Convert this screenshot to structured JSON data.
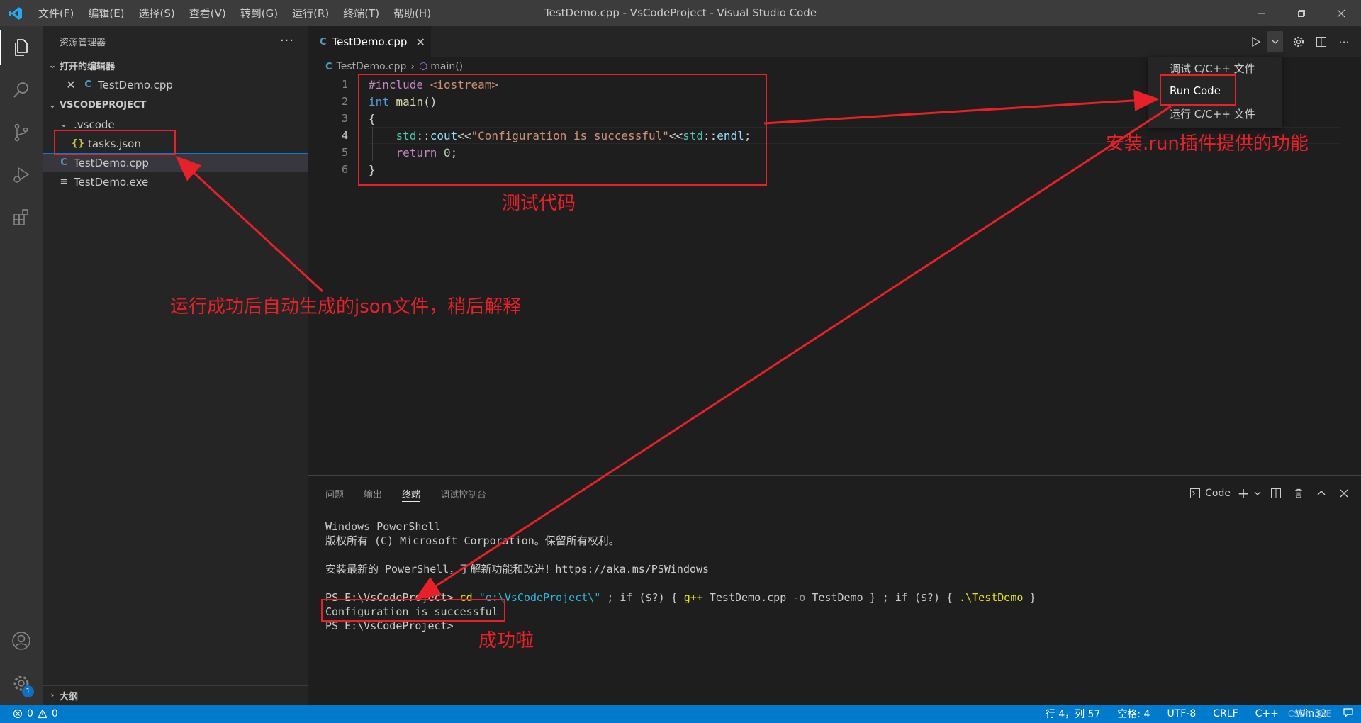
{
  "titlebar": {
    "menu": [
      "文件(F)",
      "编辑(E)",
      "选择(S)",
      "查看(V)",
      "转到(G)",
      "运行(R)",
      "终端(T)",
      "帮助(H)"
    ],
    "window_title": "TestDemo.cpp - VsCodeProject - Visual Studio Code"
  },
  "sidebar": {
    "header": "资源管理器",
    "more": "···",
    "open_editors": {
      "label": "打开的编辑器",
      "files": [
        {
          "name": "TestDemo.cpp"
        }
      ]
    },
    "project": {
      "label": "VSCODEPROJECT",
      "folder": ".vscode",
      "folder_files": [
        {
          "name": "tasks.json"
        }
      ],
      "files": [
        {
          "name": "TestDemo.cpp"
        },
        {
          "name": "TestDemo.exe"
        }
      ]
    },
    "outline": "大纲"
  },
  "activity_badge": "1",
  "tab": {
    "name": "TestDemo.cpp",
    "close": "✕"
  },
  "breadcrumb": {
    "file": "TestDemo.cpp",
    "symbol": "main()"
  },
  "editor": {
    "line_numbers": [
      "1",
      "2",
      "3",
      "4",
      "5",
      "6"
    ]
  },
  "run_menu": {
    "items": [
      "调试 C/C++ 文件",
      "Run Code",
      "运行 C/C++ 文件"
    ]
  },
  "panel": {
    "tabs": [
      "问题",
      "输出",
      "终端",
      "调试控制台"
    ],
    "active_tab": "终端",
    "terminal_name": "Code",
    "terminal": {
      "line1": "Windows PowerShell",
      "line2": "版权所有 (C) Microsoft Corporation。保留所有权利。",
      "line3": "安装最新的 PowerShell，了解新功能和改进！https://aka.ms/PSWindows",
      "prompt": "PS E:\\VsCodeProject> ",
      "cmd_cd": "cd",
      "cmd_path": "\"e:\\VsCodeProject\\\"",
      "cmd_rest1": " ; if ($?) { ",
      "cmd_gpp": "g++",
      "cmd_rest2": " TestDemo.cpp ",
      "cmd_o": "-o",
      "cmd_rest3": " TestDemo } ; if ($?) { ",
      "cmd_exe": ".\\TestDemo",
      "cmd_rest4": " }",
      "output": "Configuration is successful",
      "prompt2": "PS E:\\VsCodeProject> "
    }
  },
  "statusbar": {
    "errors": "0",
    "warnings": "0",
    "position": "行 4，列 57",
    "spaces": "空格: 4",
    "encoding": "UTF-8",
    "eol": "CRLF",
    "language": "C++",
    "platform": "Win32"
  },
  "watermark": "CSDN @IE",
  "annotations": {
    "json_note": "运行成功后自动生成的json文件，稍后解释",
    "code_note": "测试代码",
    "plugin_note": "安装.run插件提供的功能",
    "success_note": "成功啦"
  }
}
